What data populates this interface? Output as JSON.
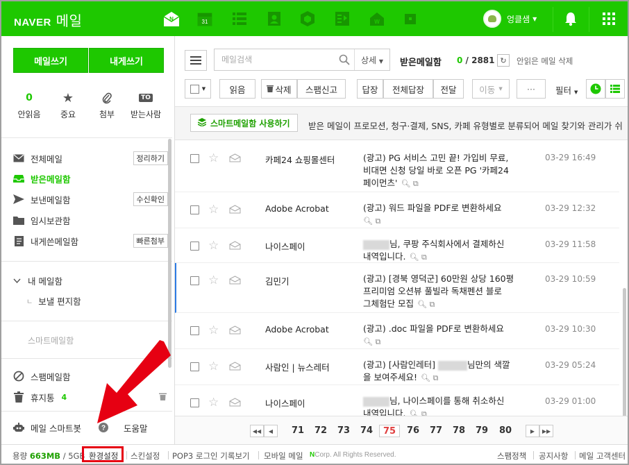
{
  "header": {
    "brand": "NAVER",
    "product": "메일",
    "user_name": "엉클샘",
    "colors": {
      "brand_green": "#1ec800",
      "alert_red": "#e60012"
    }
  },
  "sidebar": {
    "write_button": "메일쓰기",
    "self_button": "내게쓰기",
    "quick": [
      {
        "value": "0",
        "label": "안읽음"
      },
      {
        "icon": "star-icon",
        "label": "중요"
      },
      {
        "icon": "paperclip-icon",
        "label": "첨부"
      },
      {
        "badge": "TO",
        "label": "받는사람"
      }
    ],
    "folders": [
      {
        "label": "전체메일",
        "tag": "정리하기",
        "icon": "envelope-icon"
      },
      {
        "label": "받은메일함",
        "icon": "inbox-icon",
        "active": true
      },
      {
        "label": "보낸메일함",
        "tag": "수신확인",
        "icon": "send-icon"
      },
      {
        "label": "임시보관함",
        "icon": "folder-icon"
      },
      {
        "label": "내게쓴메일함",
        "tag": "빠른첨부",
        "icon": "document-icon"
      }
    ],
    "my_box": "내 메일함",
    "my_sub": "보낼 편지함",
    "smart_box": "스마트메일함",
    "spam": "스팸메일함",
    "trash": "휴지통",
    "trash_count": "4",
    "smartbot": "메일 스마트봇",
    "help": "도움말"
  },
  "toolbar": {
    "search_placeholder": "메일검색",
    "search_detail": "상세",
    "box_title": "받은메일함",
    "unread": "0",
    "total": "2881",
    "delete_read": "안읽은 메일 삭제",
    "read": "읽음",
    "delete": "삭제",
    "spam": "스팸신고",
    "reply": "답장",
    "reply_all": "전체답장",
    "forward": "전달",
    "move": "이동",
    "more": "···",
    "filter": "필터"
  },
  "smartbar": {
    "button": "스마트메일함 사용하기",
    "text": "받은 메일이 프로모션, 청구·결제, SNS, 카페 유형별로 분류되어 메일 찾기와 관리가 쉬"
  },
  "mails": [
    {
      "sender": "카페24 쇼핑몰센터",
      "subject": [
        "(광고) PG 서비스 고민 끝! 가입비 무료,",
        "비대면 신청 당일 바로 오픈 PG '카페24",
        "페이먼츠'"
      ],
      "date": "03-29 16:49"
    },
    {
      "sender": "Adobe Acrobat",
      "subject": [
        "(광고) 워드 파일을 PDF로 변환하세요"
      ],
      "date": "03-29 12:32"
    },
    {
      "sender": "나이스페이",
      "subject_pre": "",
      "subject_post": "님, 쿠팡 주식회사에서 결제하신",
      "subject": [
        "님, 쿠팡 주식회사에서 결제하신",
        "내역입니다."
      ],
      "date": "03-29 11:58"
    },
    {
      "sender": "김민기",
      "subject": [
        "(광고) [경북 영덕군] 60만원 상당 160평",
        "프리미엄 오션뷰 풀빌라 독채펜션 블로",
        "그체험단 모집"
      ],
      "date": "03-29 10:59"
    },
    {
      "sender": "Adobe Acrobat",
      "subject": [
        "(광고) .doc 파일을 PDF로 변환하세요"
      ],
      "date": "03-29 10:30"
    },
    {
      "sender": "사람인 | 뉴스레터",
      "subject": [
        "(광고) [사람인레터]",
        "님만의 색깔",
        "을 보여주세요!"
      ],
      "date": "03-29 05:24"
    },
    {
      "sender": "나이스페이",
      "subject": [
        "님, 나이스페이를 통해 취소하신",
        "내역입니다."
      ],
      "date": "03-29 01:00"
    }
  ],
  "pager": {
    "pages": [
      "71",
      "72",
      "73",
      "74",
      "75",
      "76",
      "77",
      "78",
      "79",
      "80"
    ],
    "current": "75"
  },
  "footer": {
    "usage_label": "용량",
    "usage": "663MB",
    "quota": "/ 5GB",
    "settings": "환경설정",
    "skin": "스킨설정",
    "pop3": "POP3 로그인 기록보기",
    "mobile": "모바일 메일",
    "copyright": "Corp. All Rights Reserved.",
    "spam_policy": "스팸정책",
    "notice": "공지사항",
    "support": "메일 고객센터"
  }
}
